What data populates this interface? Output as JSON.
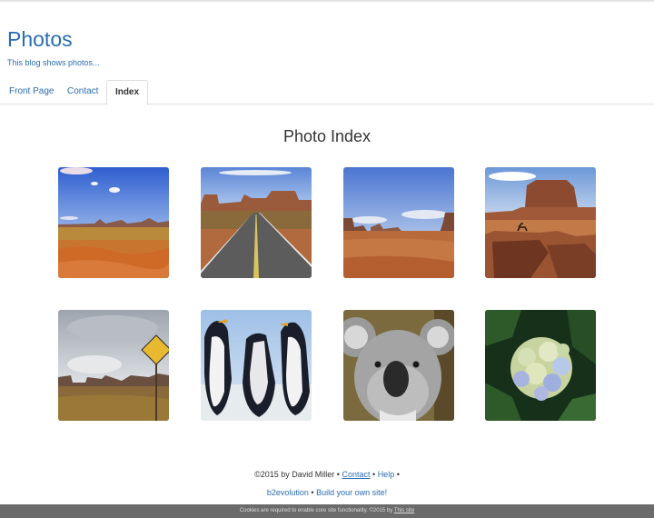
{
  "header": {
    "site_title": "Photos",
    "tagline": "This blog shows photos..."
  },
  "tabs": [
    {
      "label": "Front Page"
    },
    {
      "label": "Contact"
    },
    {
      "label": "Index",
      "active": true
    }
  ],
  "main": {
    "title": "Photo Index",
    "photos": [
      {
        "subject": "desert-landscape"
      },
      {
        "subject": "desert-road"
      },
      {
        "subject": "desert-valley"
      },
      {
        "subject": "horse-rider-cliff"
      },
      {
        "subject": "road-sign-cloudy"
      },
      {
        "subject": "penguins"
      },
      {
        "subject": "koala"
      },
      {
        "subject": "hydrangea-flower"
      }
    ]
  },
  "footer": {
    "copyright": "©2015 by David Miller •",
    "contact_link": "Contact",
    "sep1": "•",
    "help_link": "Help",
    "sep2": "•",
    "b2evo_link": "b2evolution",
    "sep3": "•",
    "build_link": "Build your own site!"
  },
  "cookie_bar": {
    "text": "Cookies are required to enable core site functionality. ©2015 by",
    "link": "This site"
  },
  "colors": {
    "link": "#2a6db0",
    "cookie_bar_bg": "#6b6b6b"
  }
}
